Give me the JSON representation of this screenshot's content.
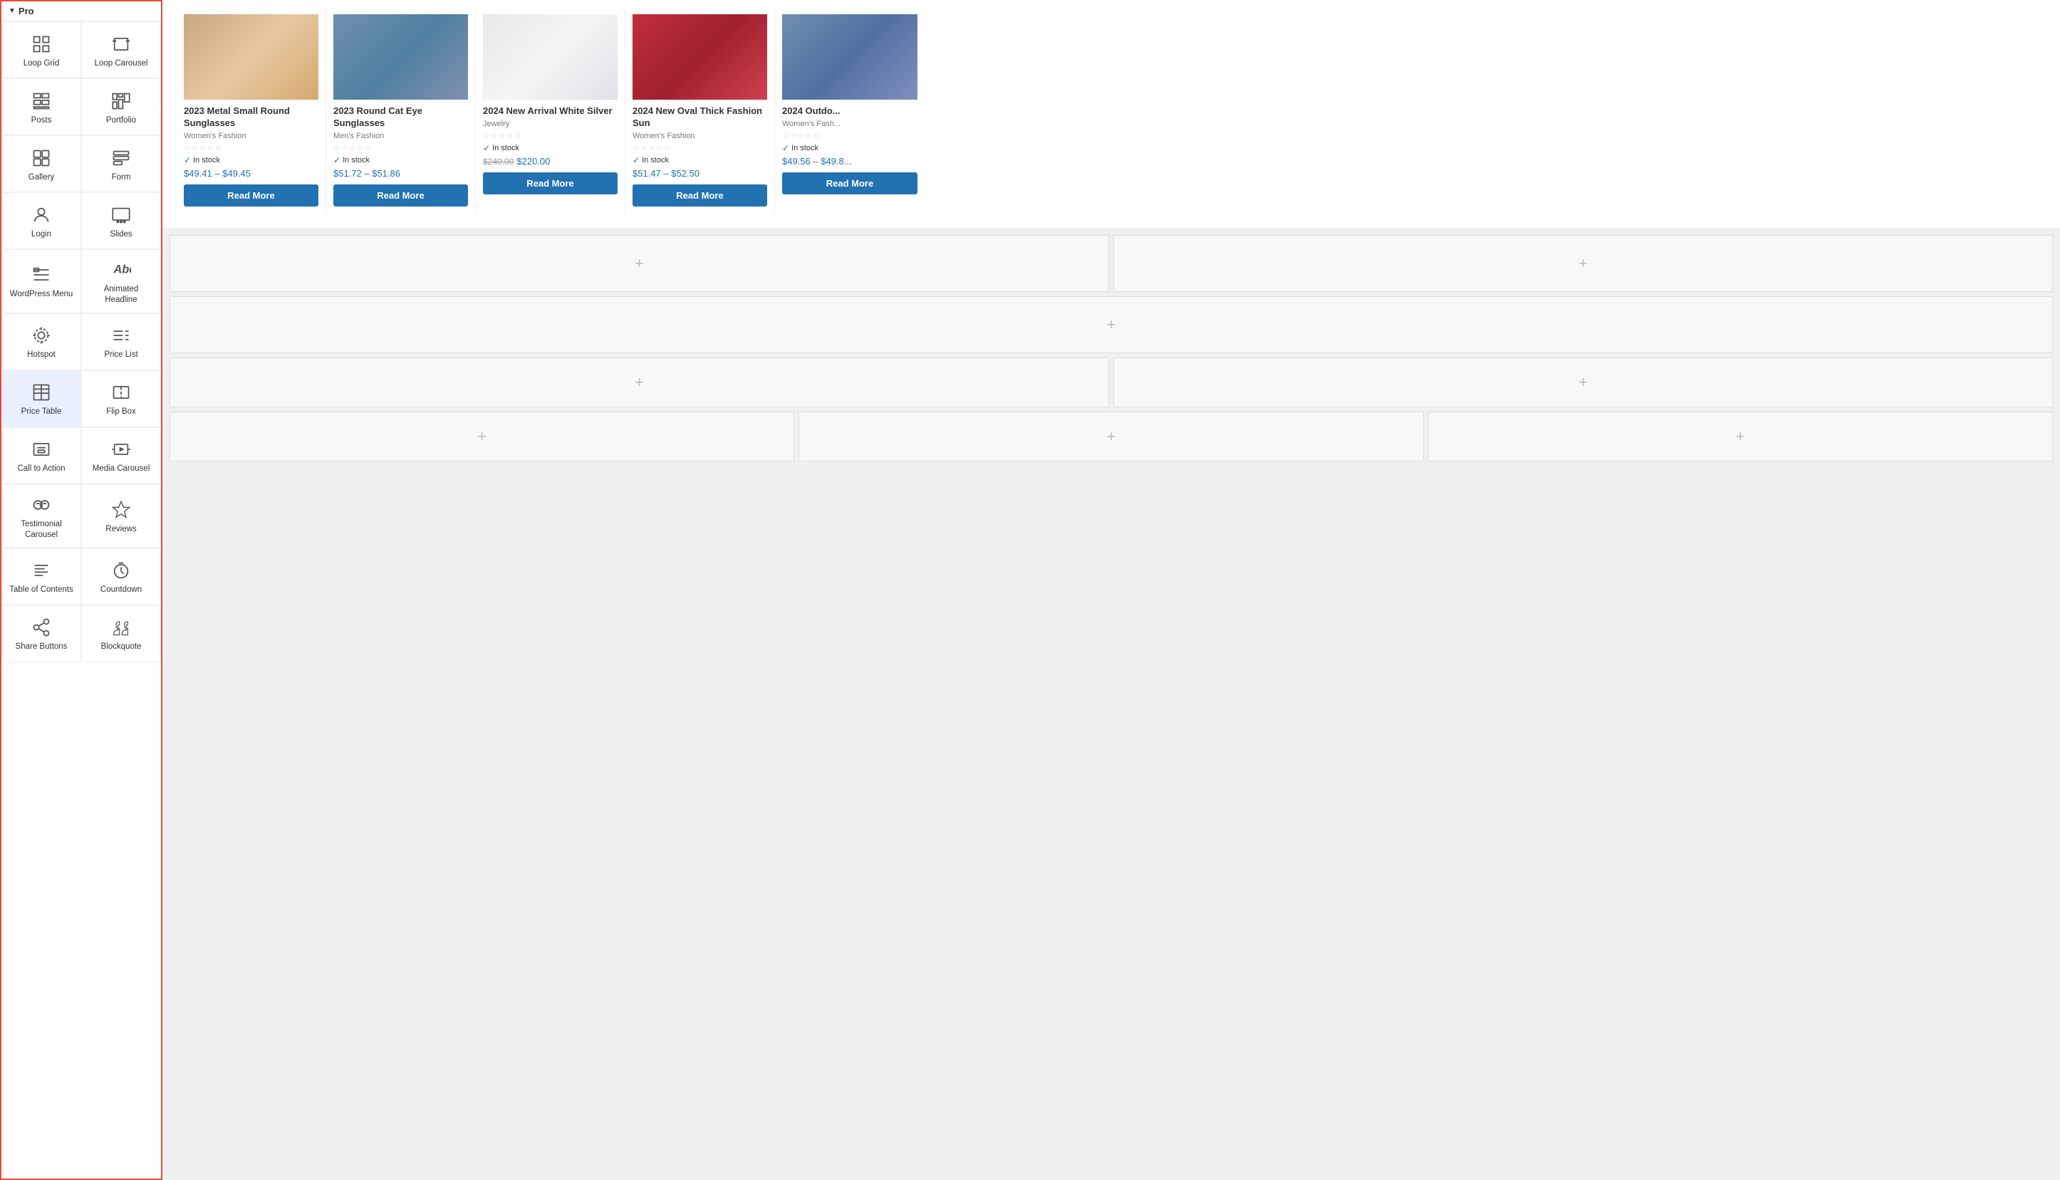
{
  "sidebar": {
    "header": "Pro",
    "widgets": [
      {
        "id": "loop-grid",
        "label": "Loop Grid",
        "icon": "loop-grid"
      },
      {
        "id": "loop-carousel",
        "label": "Loop Carousel",
        "icon": "loop-carousel"
      },
      {
        "id": "posts",
        "label": "Posts",
        "icon": "posts"
      },
      {
        "id": "portfolio",
        "label": "Portfolio",
        "icon": "portfolio"
      },
      {
        "id": "gallery",
        "label": "Gallery",
        "icon": "gallery"
      },
      {
        "id": "form",
        "label": "Form",
        "icon": "form"
      },
      {
        "id": "login",
        "label": "Login",
        "icon": "login"
      },
      {
        "id": "slides",
        "label": "Slides",
        "icon": "slides"
      },
      {
        "id": "wordpress-menu",
        "label": "WordPress Menu",
        "icon": "wordpress-menu"
      },
      {
        "id": "animated-headline",
        "label": "Animated Headline",
        "icon": "animated-headline"
      },
      {
        "id": "hotspot",
        "label": "Hotspot",
        "icon": "hotspot"
      },
      {
        "id": "price-list",
        "label": "Price List",
        "icon": "price-list"
      },
      {
        "id": "price-table",
        "label": "Price Table",
        "icon": "price-table",
        "active": true
      },
      {
        "id": "flip-box",
        "label": "Flip Box",
        "icon": "flip-box"
      },
      {
        "id": "call-to-action",
        "label": "Call to Action",
        "icon": "call-to-action"
      },
      {
        "id": "media-carousel",
        "label": "Media Carousel",
        "icon": "media-carousel"
      },
      {
        "id": "testimonial-carousel",
        "label": "Testimonial Carousel",
        "icon": "testimonial-carousel"
      },
      {
        "id": "reviews",
        "label": "Reviews",
        "icon": "reviews"
      },
      {
        "id": "table-of-contents",
        "label": "Table of Contents",
        "icon": "table-of-contents"
      },
      {
        "id": "countdown",
        "label": "Countdown",
        "icon": "countdown"
      },
      {
        "id": "share-buttons",
        "label": "Share Buttons",
        "icon": "share-buttons"
      },
      {
        "id": "blockquote",
        "label": "Blockquote",
        "icon": "blockquote"
      }
    ]
  },
  "products": [
    {
      "id": "p1",
      "title": "2023 Metal Small Round Sunglasses",
      "category": "Women's Fashion",
      "stars": "☆☆☆☆☆",
      "stock": "In stock",
      "price": "$49.41 – $49.45",
      "imgClass": "img-sunglasses1",
      "readMoreLabel": "Read More"
    },
    {
      "id": "p2",
      "title": "2023 Round Cat Eye Sunglasses",
      "category": "Men's Fashion",
      "stars": "☆☆☆☆☆",
      "stock": "In stock",
      "price": "$51.72 – $51.86",
      "imgClass": "img-sunglasses2",
      "readMoreLabel": "Read More"
    },
    {
      "id": "p3",
      "title": "2024 New Arrival White Silver",
      "category": "Jewelry",
      "stars": "☆☆☆☆☆",
      "stock": "In stock",
      "priceOriginal": "$240.00",
      "price": "$220.00",
      "imgClass": "img-jewelry",
      "readMoreLabel": "Read More"
    },
    {
      "id": "p4",
      "title": "2024 New Oval Thick Fashion Sun",
      "category": "Women's Fashion",
      "stars": "☆☆☆☆☆",
      "stock": "In stock",
      "price": "$51.47 – $52.50",
      "imgClass": "img-fashion",
      "readMoreLabel": "Read More"
    },
    {
      "id": "p5",
      "title": "2024 Outdo...",
      "category": "Women's Fash...",
      "stars": "☆☆☆☆☆",
      "stock": "In stock",
      "price": "$49.56 – $49.8...",
      "imgClass": "img-outdoor",
      "readMoreLabel": "Read More"
    }
  ],
  "canvas": {
    "plus_label": "+"
  }
}
